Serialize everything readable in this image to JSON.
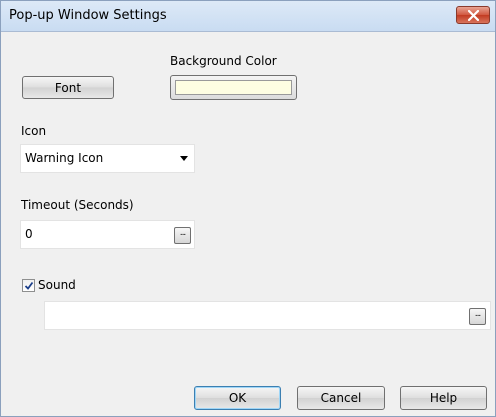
{
  "window": {
    "title": "Pop-up Window Settings"
  },
  "font": {
    "button_label": "Font"
  },
  "background_color": {
    "label": "Background Color",
    "color": "#fefee2"
  },
  "icon": {
    "label": "Icon",
    "selected": "Warning Icon"
  },
  "timeout": {
    "label": "Timeout (Seconds)",
    "value": "0",
    "browse_label": "..."
  },
  "sound": {
    "label": "Sound",
    "checked": true,
    "value": "",
    "browse_label": "..."
  },
  "buttons": {
    "ok": "OK",
    "cancel": "Cancel",
    "help": "Help"
  },
  "colors": {
    "window_bg": "#f0f0f0",
    "close_button": "#c9452c",
    "default_button_border": "#3c7fb1"
  }
}
